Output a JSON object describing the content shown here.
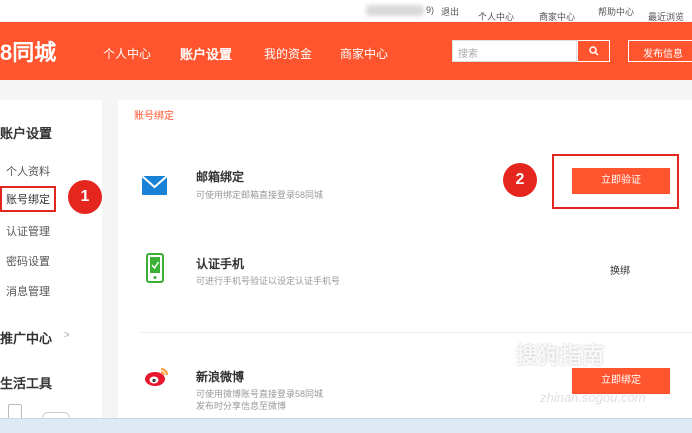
{
  "topbar": {
    "user_suffix": "9)",
    "logout": "退出",
    "personal_center": "个人中心",
    "merchant_center": "商家中心",
    "help_center": "帮助中心",
    "recent_browse": "最近浏览"
  },
  "header": {
    "logo": "8同城",
    "nav": [
      "个人中心",
      "账户设置",
      "我的资金",
      "商家中心"
    ],
    "search_placeholder": "搜索",
    "publish": "发布信息"
  },
  "sidebar": {
    "account_settings": "账户设置",
    "items": [
      "个人资料",
      "账号绑定",
      "认证管理",
      "密码设置",
      "消息管理"
    ],
    "promo_center": "推广中心",
    "life_tools": "生活工具"
  },
  "main": {
    "breadcrumb": "账号绑定",
    "rows": [
      {
        "title": "邮箱绑定",
        "desc": "可使用绑定邮箱直接登录58同城",
        "action": "立即验证",
        "icon": "mail-icon"
      },
      {
        "title": "认证手机",
        "desc": "可进行手机号验证以设定认证手机号",
        "action": "换绑",
        "icon": "phone-icon"
      },
      {
        "title": "新浪微博",
        "desc": "可使用微博账号直接登录58同城",
        "desc2": "发布时分享信息至微博",
        "action": "立即绑定",
        "icon": "weibo-icon"
      }
    ]
  },
  "badges": [
    "1",
    "2"
  ],
  "watermark": {
    "main": "搜狗指南",
    "sub": "zhinan.sogou.com"
  },
  "colors": {
    "brand": "#ff552e",
    "annotation": "#e5261f",
    "mail": "#1a82d6",
    "phone": "#3cb035"
  }
}
